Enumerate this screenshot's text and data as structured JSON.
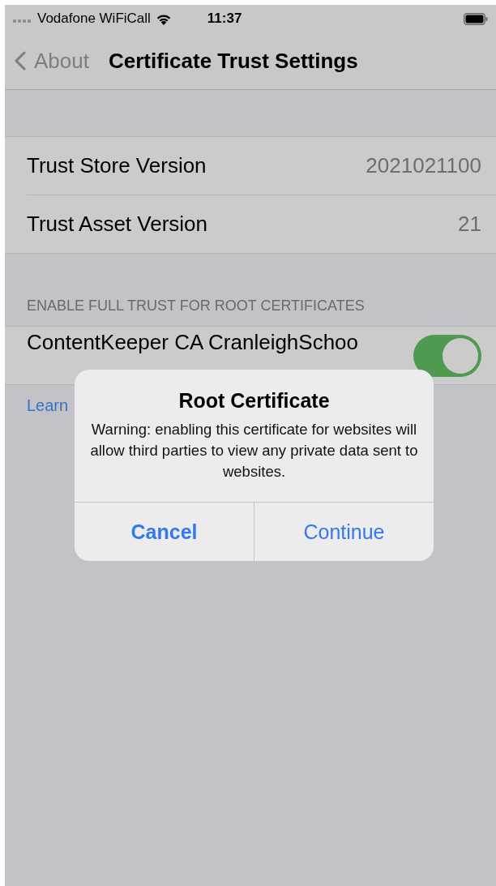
{
  "status_bar": {
    "carrier": "Vodafone WiFiCall",
    "time": "11:37"
  },
  "nav": {
    "back": "About",
    "title": "Certificate Trust Settings"
  },
  "versions": [
    {
      "label": "Trust Store Version",
      "value": "2021021100"
    },
    {
      "label": "Trust Asset Version",
      "value": "21"
    }
  ],
  "trust_section": {
    "header": "ENABLE FULL TRUST FOR ROOT CERTIFICATES",
    "certificates": [
      {
        "name": "ContentKeeper CA CranleighSchoo",
        "on": true
      }
    ],
    "link": "Learn"
  },
  "alert": {
    "title": "Root Certificate",
    "message": "Warning: enabling this certificate for websites will allow third parties to view any private data sent to websites.",
    "buttons": [
      {
        "label": "Cancel",
        "kind": "cancel"
      },
      {
        "label": "Continue",
        "kind": "default"
      }
    ]
  }
}
